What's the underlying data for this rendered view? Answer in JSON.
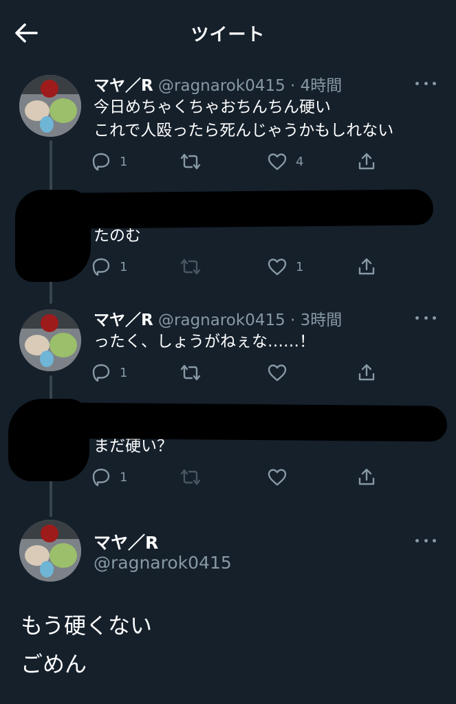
{
  "header": {
    "title": "ツイート"
  },
  "tweets": [
    {
      "name": "マヤ／R",
      "handle": "@ragnarok0415",
      "sep": "·",
      "time": "4時間",
      "lines": [
        "今日めちゃくちゃおちんちん硬い",
        "これで人殴ったら死んじゃうかもしれない"
      ],
      "reply_count": "1",
      "retweet_count": "",
      "like_count": "4"
    },
    {
      "name": "",
      "handle": "",
      "time": "",
      "lines": [
        "たのむ"
      ],
      "reply_count": "1",
      "retweet_count": "",
      "like_count": "1"
    },
    {
      "name": "マヤ／R",
      "handle": "@ragnarok0415",
      "sep": "·",
      "time": "3時間",
      "lines": [
        "ったく、しょうがねぇな……！"
      ],
      "reply_count": "1",
      "retweet_count": "",
      "like_count": ""
    },
    {
      "name": "",
      "handle": "",
      "time": "",
      "lines": [
        "まだ硬い？"
      ],
      "reply_count": "1",
      "retweet_count": "",
      "like_count": ""
    }
  ],
  "main_tweet": {
    "name": "マヤ／R",
    "handle": "@ragnarok0415",
    "lines": [
      "もう硬くない",
      "ごめん"
    ]
  },
  "colors": {
    "background": "#15202b",
    "text": "#ffffff",
    "secondary": "#8899a6",
    "thread_line": "#38444d",
    "redaction": "#000000"
  },
  "icons": [
    "back-arrow-icon",
    "more-icon",
    "reply-icon",
    "retweet-icon",
    "like-icon",
    "share-icon"
  ]
}
